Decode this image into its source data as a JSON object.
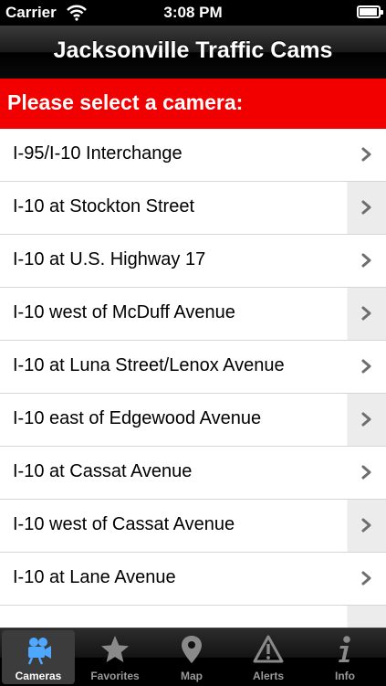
{
  "status_bar": {
    "carrier": "Carrier",
    "time": "3:08 PM",
    "battery_level": 0.95
  },
  "nav_bar": {
    "title": "Jacksonville Traffic Cams"
  },
  "section_header": {
    "label": "Please select a camera:"
  },
  "cameras": [
    {
      "label": "I-95/I-10 Interchange"
    },
    {
      "label": "I-10 at Stockton Street"
    },
    {
      "label": "I-10 at U.S. Highway 17"
    },
    {
      "label": "I-10 west of McDuff Avenue"
    },
    {
      "label": "I-10 at Luna Street/Lenox Avenue"
    },
    {
      "label": "I-10 east of Edgewood Avenue"
    },
    {
      "label": "I-10 at Cassat Avenue"
    },
    {
      "label": "I-10 west of Cassat Avenue"
    },
    {
      "label": "I-10 at Lane Avenue"
    },
    {
      "label": ""
    }
  ],
  "tabs": [
    {
      "label": "Cameras",
      "icon": "video-camera-icon",
      "active": true
    },
    {
      "label": "Favorites",
      "icon": "star-icon",
      "active": false
    },
    {
      "label": "Map",
      "icon": "map-pin-icon",
      "active": false
    },
    {
      "label": "Alerts",
      "icon": "warning-icon",
      "active": false
    },
    {
      "label": "Info",
      "icon": "info-icon",
      "active": false
    }
  ],
  "colors": {
    "header_red": "#f20000",
    "tab_active_bg": "#3c3c3c",
    "icon_active": "#4fa8ff"
  }
}
